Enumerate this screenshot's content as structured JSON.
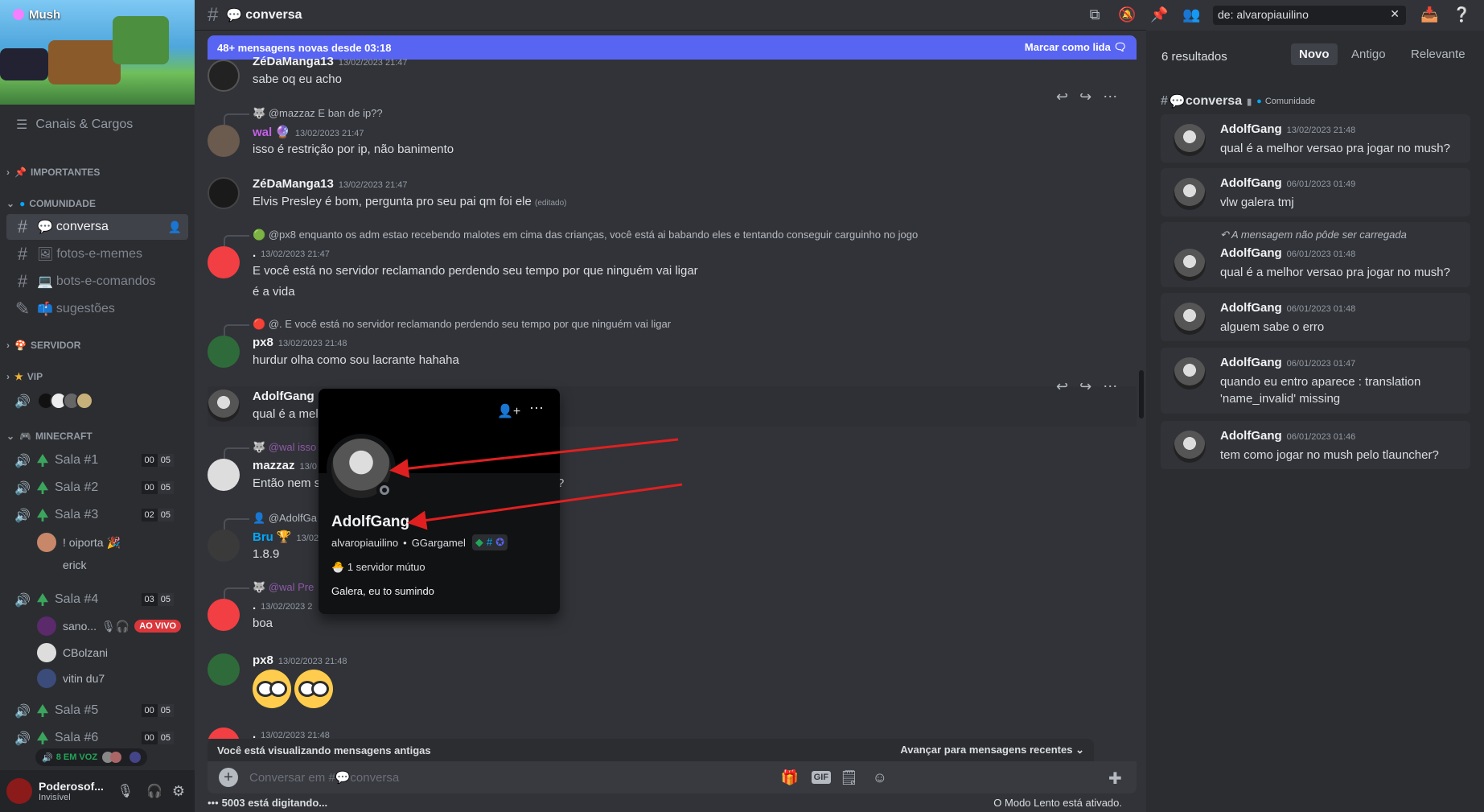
{
  "server": {
    "name": "Mush",
    "channels_roles": "Canais & Cargos"
  },
  "categories": {
    "importantes": "IMPORTANTES",
    "comunidade": "COMUNIDADE",
    "servidor": "SERVIDOR",
    "vip": "VIP",
    "minecraft": "MINECRAFT"
  },
  "channels": [
    {
      "name": "conversa",
      "selected": true
    },
    {
      "name": "fotos-e-memes"
    },
    {
      "name": "bots-e-comandos"
    },
    {
      "name": "sugestões"
    }
  ],
  "voice": [
    {
      "name": "Sala #1",
      "a": "00",
      "b": "05"
    },
    {
      "name": "Sala #2",
      "a": "00",
      "b": "05"
    },
    {
      "name": "Sala #3",
      "a": "02",
      "b": "05"
    },
    {
      "name": "Sala #4",
      "a": "03",
      "b": "05"
    },
    {
      "name": "Sala #5",
      "a": "00",
      "b": "05"
    },
    {
      "name": "Sala #6",
      "a": "00",
      "b": "05"
    }
  ],
  "voice_users": {
    "u1": "! oiporta",
    "u2": "erick",
    "u3": "sano...",
    "u4": "CBolzani",
    "u5": "vitin du7",
    "live": "AO VIVO",
    "in_voice": "8 EM VOZ"
  },
  "user": {
    "name": "Poderosof...",
    "status": "Invisível"
  },
  "header": {
    "channel": "conversa",
    "search": "de: alvaropiauilino"
  },
  "banner": {
    "text": "48+ mensagens novas desde 03:18",
    "action": "Marcar como lida"
  },
  "messages": {
    "m1": {
      "author": "ZéDaManga13",
      "time": "13/02/2023 21:47",
      "text": "sabe oq eu acho"
    },
    "m2": {
      "reply": "@mazzaz E ban de ip??",
      "author": "wal",
      "time": "13/02/2023 21:47",
      "text": "isso é restrição por ip, não banimento"
    },
    "m3": {
      "author": "ZéDaManga13",
      "time": "13/02/2023 21:47",
      "text": "Elvis Presley é bom, pergunta pro seu pai qm foi ele",
      "edited": "(editado)"
    },
    "m4": {
      "reply": "@px8 enquanto os adm estao recebendo malotes em cima das crianças, você está ai babando eles e tentando conseguir carguinho no jogo",
      "author": ".",
      "time": "13/02/2023 21:47",
      "text": "E você está no servidor reclamando perdendo seu tempo por que ninguém vai ligar",
      "text2": "é a vida"
    },
    "m5": {
      "reply": "@. E você está no servidor reclamando perdendo seu tempo por que ninguém vai ligar",
      "author": "px8",
      "time": "13/02/2023 21:48",
      "text": "hurdur olha como sou lacrante hahaha"
    },
    "m6": {
      "author": "AdolfGang",
      "text": "qual é a mel"
    },
    "m7": {
      "reply": "@wal isso",
      "author": "mazzaz",
      "time": "13/0",
      "text": "Então nem s",
      "tail": "?"
    },
    "m8": {
      "reply": "@AdolfGa",
      "author": "Bru",
      "time": "13/02",
      "text": "1.8.9"
    },
    "m9": {
      "reply": "@wal Pre",
      "author": ".",
      "time": "13/02/2023 2",
      "text": "boa"
    },
    "m10": {
      "author": "px8",
      "time": "13/02/2023 21:48"
    },
    "m11": {
      "author": ".",
      "time": "13/02/2023 21:48"
    }
  },
  "old_bar": {
    "left": "Você está visualizando mensagens antigas",
    "right": "Avançar para mensagens recentes"
  },
  "input": {
    "placeholder": "Conversar em #",
    "channel": "conversa"
  },
  "status": {
    "typing": "5003 está digitando...",
    "slow": "O Modo Lento está ativado."
  },
  "popup": {
    "name": "AdolfGang",
    "username": "alvaropiauilino",
    "tag": "GGargamel",
    "mutual": "1 servidor mútuo",
    "bio": "Galera, eu to sumindo"
  },
  "search_panel": {
    "count": "6 resultados",
    "tabs": [
      "Novo",
      "Antigo",
      "Relevante"
    ],
    "channel": "conversa",
    "category": "Comunidade",
    "not_loaded": "A mensagem não pôde ser carregada",
    "results": [
      {
        "author": "AdolfGang",
        "time": "13/02/2023 21:48",
        "text": "qual é a melhor versao pra jogar no mush?"
      },
      {
        "author": "AdolfGang",
        "time": "06/01/2023 01:49",
        "text": "vlw galera tmj"
      },
      {
        "author": "AdolfGang",
        "time": "06/01/2023 01:48",
        "text": "qual é a melhor versao pra jogar no mush?"
      },
      {
        "author": "AdolfGang",
        "time": "06/01/2023 01:48",
        "text": "alguem sabe o erro"
      },
      {
        "author": "AdolfGang",
        "time": "06/01/2023 01:47",
        "text": "quando eu entro aparece : translation 'name_invalid' missing"
      },
      {
        "author": "AdolfGang",
        "time": "06/01/2023 01:46",
        "text": "tem como jogar no mush pelo tlauncher?"
      }
    ]
  }
}
